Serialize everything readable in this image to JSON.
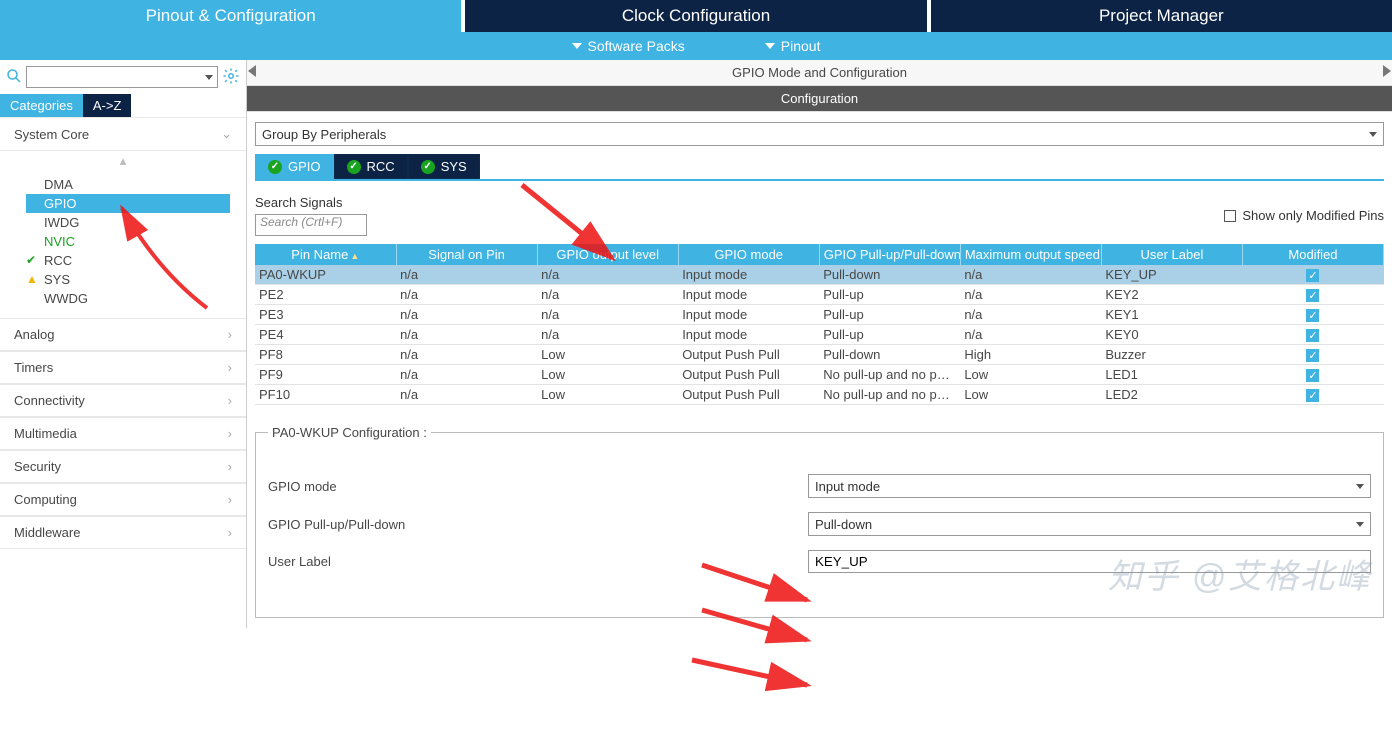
{
  "main_tabs": {
    "pinout": "Pinout & Configuration",
    "clock": "Clock Configuration",
    "project": "Project Manager"
  },
  "sub": {
    "software_packs": "Software Packs",
    "pinout": "Pinout"
  },
  "side": {
    "tabs": {
      "categories": "Categories",
      "a_z": "A->Z"
    },
    "groups": {
      "system_core": "System Core",
      "analog": "Analog",
      "timers": "Timers",
      "connectivity": "Connectivity",
      "multimedia": "Multimedia",
      "security": "Security",
      "computing": "Computing",
      "middleware": "Middleware"
    },
    "system_items": {
      "dma": "DMA",
      "gpio": "GPIO",
      "iwdg": "IWDG",
      "nvic": "NVIC",
      "rcc": "RCC",
      "sys": "SYS",
      "wwdg": "WWDG"
    }
  },
  "panel": {
    "title": "GPIO Mode and Configuration",
    "config_title": "Configuration",
    "group_by": "Group By Peripherals",
    "tabs": {
      "gpio": "GPIO",
      "rcc": "RCC",
      "sys": "SYS"
    },
    "search_signals_label": "Search Signals",
    "search_placeholder": "Search (Crtl+F)",
    "show_only_modified": "Show only Modified Pins",
    "columns": {
      "pin": "Pin Name",
      "signal": "Signal on Pin",
      "level": "GPIO output level",
      "mode": "GPIO mode",
      "pull": "GPIO Pull-up/Pull-down",
      "speed": "Maximum output speed",
      "label": "User Label",
      "modified": "Modified"
    },
    "rows": [
      {
        "pin": "PA0-WKUP",
        "signal": "n/a",
        "level": "n/a",
        "mode": "Input mode",
        "pull": "Pull-down",
        "speed": "n/a",
        "label": "KEY_UP"
      },
      {
        "pin": "PE2",
        "signal": "n/a",
        "level": "n/a",
        "mode": "Input mode",
        "pull": "Pull-up",
        "speed": "n/a",
        "label": "KEY2"
      },
      {
        "pin": "PE3",
        "signal": "n/a",
        "level": "n/a",
        "mode": "Input mode",
        "pull": "Pull-up",
        "speed": "n/a",
        "label": "KEY1"
      },
      {
        "pin": "PE4",
        "signal": "n/a",
        "level": "n/a",
        "mode": "Input mode",
        "pull": "Pull-up",
        "speed": "n/a",
        "label": "KEY0"
      },
      {
        "pin": "PF8",
        "signal": "n/a",
        "level": "Low",
        "mode": "Output Push Pull",
        "pull": "Pull-down",
        "speed": "High",
        "label": "Buzzer"
      },
      {
        "pin": "PF9",
        "signal": "n/a",
        "level": "Low",
        "mode": "Output Push Pull",
        "pull": "No pull-up and no pull…",
        "speed": "Low",
        "label": "LED1"
      },
      {
        "pin": "PF10",
        "signal": "n/a",
        "level": "Low",
        "mode": "Output Push Pull",
        "pull": "No pull-up and no pull…",
        "speed": "Low",
        "label": "LED2"
      }
    ]
  },
  "pin_config": {
    "legend": "PA0-WKUP Configuration :",
    "mode_label": "GPIO mode",
    "mode_value": "Input mode",
    "pull_label": "GPIO Pull-up/Pull-down",
    "pull_value": "Pull-down",
    "userlabel_label": "User Label",
    "userlabel_value": "KEY_UP"
  },
  "watermark": "知乎 @艾格北峰"
}
